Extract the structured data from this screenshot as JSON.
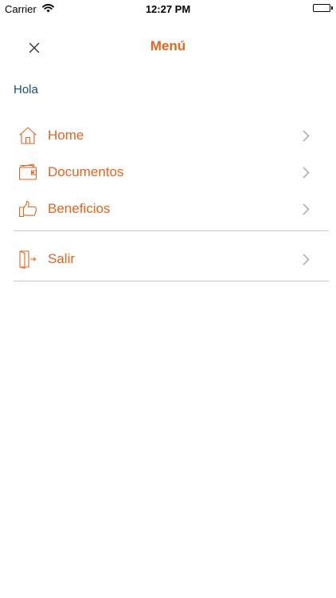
{
  "status_bar": {
    "carrier": "Carrier",
    "time": "12:27 PM",
    "battery_level": 1.0
  },
  "nav": {
    "title": "Menú",
    "close_icon": "close-icon"
  },
  "greeting": "Hola",
  "menu": {
    "items": [
      {
        "label": "Home",
        "icon": "home-icon"
      },
      {
        "label": "Documentos",
        "icon": "wallet-icon"
      },
      {
        "label": "Beneficios",
        "icon": "thumbs-up-icon"
      }
    ],
    "logout": {
      "label": "Salir",
      "icon": "exit-door-icon"
    }
  },
  "colors": {
    "accent": "#e5651f",
    "greeting": "#1f4e70",
    "divider": "#c8c8c8",
    "chevron": "#b0b0b0"
  }
}
